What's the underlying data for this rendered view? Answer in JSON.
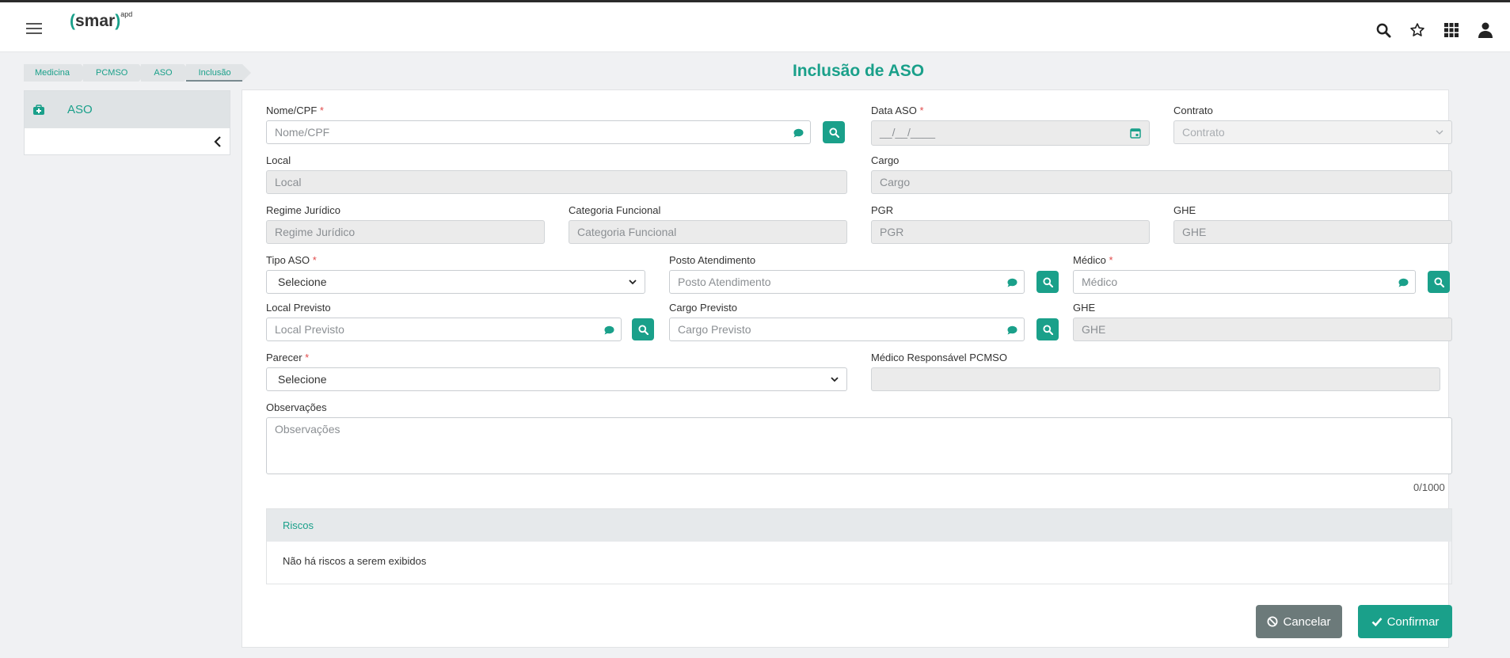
{
  "header": {
    "logo_main": "smar",
    "logo_sup": "apd"
  },
  "breadcrumb": [
    "Medicina",
    "PCMSO",
    "ASO",
    "Inclusão"
  ],
  "page_title": "Inclusão de ASO",
  "sidebar": {
    "items": [
      {
        "label": "ASO"
      }
    ]
  },
  "form": {
    "nome_cpf": {
      "label": "Nome/CPF",
      "required": "*",
      "placeholder": "Nome/CPF"
    },
    "data_aso": {
      "label": "Data ASO",
      "required": "*",
      "placeholder": "__/__/____"
    },
    "contrato": {
      "label": "Contrato",
      "placeholder": "Contrato"
    },
    "local": {
      "label": "Local",
      "placeholder": "Local"
    },
    "cargo": {
      "label": "Cargo",
      "placeholder": "Cargo"
    },
    "regime": {
      "label": "Regime Jurídico",
      "placeholder": "Regime Jurídico"
    },
    "categoria": {
      "label": "Categoria Funcional",
      "placeholder": "Categoria Funcional"
    },
    "pgr": {
      "label": "PGR",
      "placeholder": "PGR"
    },
    "ghe1": {
      "label": "GHE",
      "placeholder": "GHE"
    },
    "tipo_aso": {
      "label": "Tipo ASO",
      "required": "*",
      "value": "Selecione"
    },
    "posto": {
      "label": "Posto Atendimento",
      "placeholder": "Posto Atendimento"
    },
    "medico": {
      "label": "Médico",
      "required": "*",
      "placeholder": "Médico"
    },
    "local_previsto": {
      "label": "Local Previsto",
      "placeholder": "Local Previsto"
    },
    "cargo_previsto": {
      "label": "Cargo Previsto",
      "placeholder": "Cargo Previsto"
    },
    "ghe2": {
      "label": "GHE",
      "placeholder": "GHE"
    },
    "parecer": {
      "label": "Parecer",
      "required": "*",
      "value": "Selecione"
    },
    "medico_resp": {
      "label": "Médico Responsável PCMSO",
      "value": ""
    },
    "observacoes": {
      "label": "Observações",
      "placeholder": "Observações",
      "counter": "0/1000"
    }
  },
  "riscos": {
    "title": "Riscos",
    "empty": "Não há riscos a serem exibidos"
  },
  "actions": {
    "cancel": "Cancelar",
    "confirm": "Confirmar"
  },
  "colors": {
    "accent": "#1aa08a",
    "cancel": "#6c7a7a",
    "required": "#e14b4b"
  }
}
